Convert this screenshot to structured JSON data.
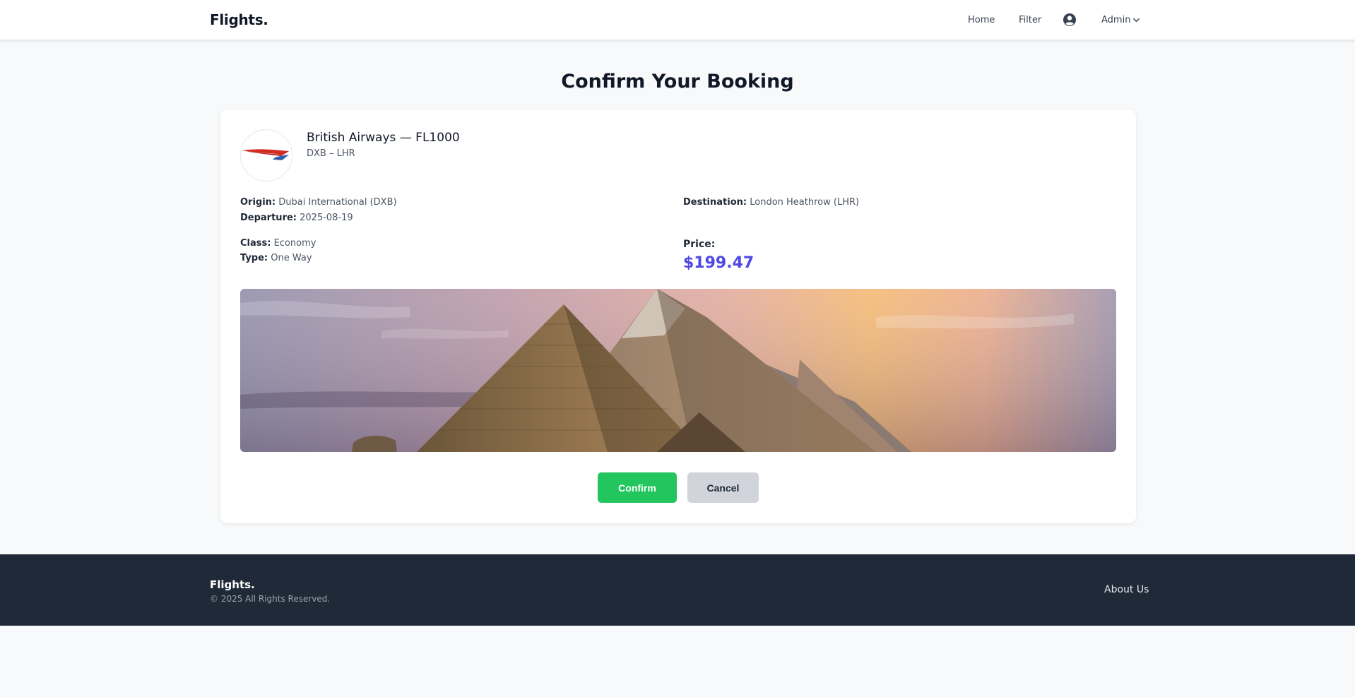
{
  "header": {
    "brand": "Flights.",
    "nav": {
      "home": "Home",
      "filter": "Filter",
      "admin": "Admin"
    },
    "icons": {
      "user": "user-circle-icon",
      "chevron": "chevron-down-icon"
    }
  },
  "page": {
    "title": "Confirm Your Booking"
  },
  "booking": {
    "airline_title": "British Airways — FL1000",
    "route": "DXB – LHR",
    "origin_label": "Origin:",
    "origin_value": "Dubai International (DXB)",
    "departure_label": "Departure:",
    "departure_value": "2025-08-19",
    "destination_label": "Destination:",
    "destination_value": "London Heathrow (LHR)",
    "class_label": "Class:",
    "class_value": "Economy",
    "type_label": "Type:",
    "type_value": "One Way",
    "price_label": "Price:",
    "price_value": "$199.47",
    "logo": "british-airways-logo",
    "banner": "pyramids-sunset-image"
  },
  "actions": {
    "confirm": "Confirm",
    "cancel": "Cancel"
  },
  "footer": {
    "brand": "Flights.",
    "copyright": "© 2025 All Rights Reserved.",
    "about": "About Us"
  },
  "colors": {
    "accent_price": "#4f46e5",
    "confirm": "#22c55e",
    "cancel": "#d1d5db",
    "footer_bg": "#1f2937"
  }
}
